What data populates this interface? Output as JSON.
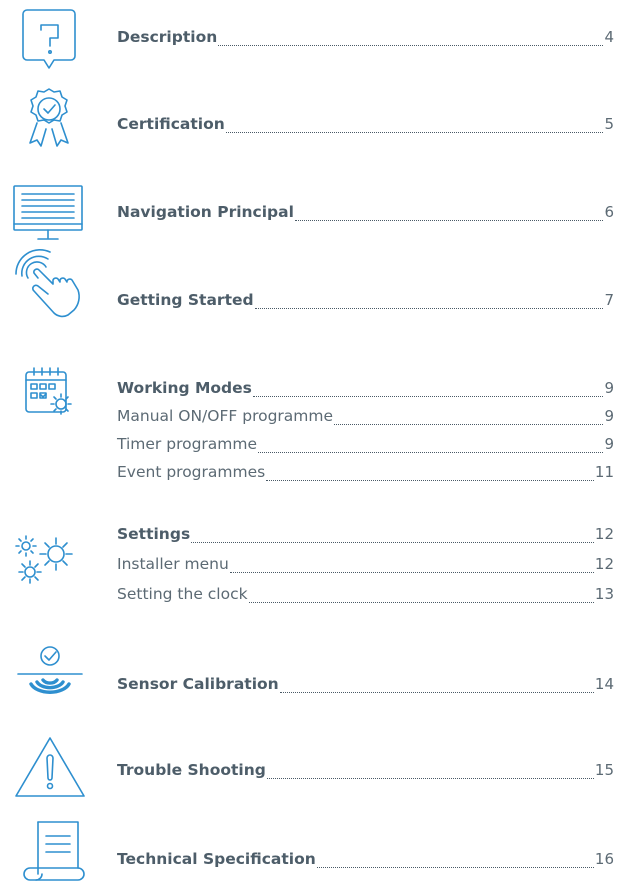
{
  "colors": {
    "icon": "#2e8fcf",
    "text": "#4d5d69"
  },
  "toc": [
    {
      "icon": "question-bubble-icon",
      "items": [
        {
          "label": "Description",
          "page": "4",
          "bold": true
        }
      ]
    },
    {
      "icon": "certification-badge-icon",
      "items": [
        {
          "label": "Certification",
          "page": "5",
          "bold": true
        }
      ]
    },
    {
      "icon": "monitor-icon",
      "items": [
        {
          "label": "Navigation Principal",
          "page": "6",
          "bold": true
        }
      ]
    },
    {
      "icon": "touch-hand-icon",
      "items": [
        {
          "label": "Getting Started",
          "page": "7",
          "bold": true
        }
      ]
    },
    {
      "icon": "calendar-gear-icon",
      "items": [
        {
          "label": "Working Modes",
          "page": "9",
          "bold": true
        },
        {
          "label": "Manual ON/OFF programme",
          "page": "9",
          "bold": false
        },
        {
          "label": "Timer programme",
          "page": "9",
          "bold": false
        },
        {
          "label": "Event programmes",
          "page": "11",
          "bold": false
        }
      ]
    },
    {
      "icon": "gears-icon",
      "items": [
        {
          "label": "Settings",
          "page": "12",
          "bold": true
        },
        {
          "label": "Installer menu",
          "page": "12",
          "bold": false
        },
        {
          "label": "Setting the clock",
          "page": "13",
          "bold": false
        }
      ]
    },
    {
      "icon": "sensor-wave-icon",
      "items": [
        {
          "label": "Sensor Calibration",
          "page": "14",
          "bold": true
        }
      ]
    },
    {
      "icon": "warning-triangle-icon",
      "items": [
        {
          "label": "Trouble Shooting",
          "page": "15",
          "bold": true
        }
      ]
    },
    {
      "icon": "scroll-document-icon",
      "items": [
        {
          "label": "Technical Specification",
          "page": "16",
          "bold": true
        }
      ]
    }
  ]
}
